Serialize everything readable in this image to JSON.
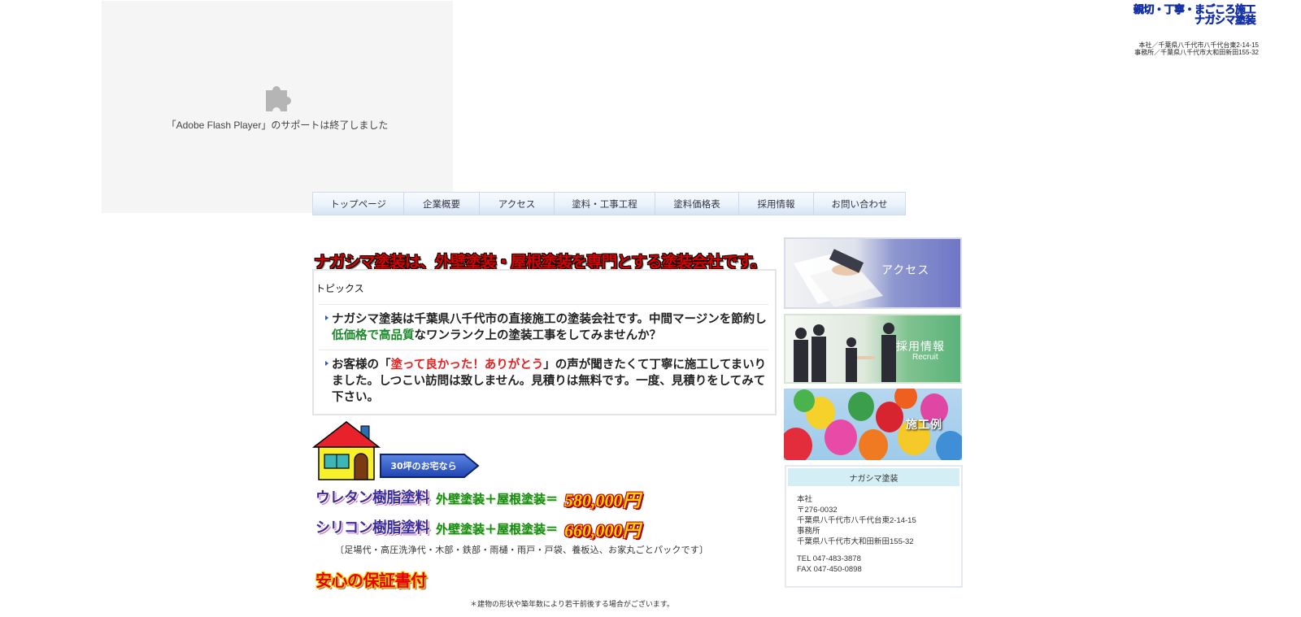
{
  "flash": {
    "message": "「Adobe Flash Player」のサポートは終了しました",
    "icon": "puzzle-piece-icon"
  },
  "header": {
    "title_line1": "親切・丁寧・まごころ施工",
    "title_line2": "ナガシマ塗装",
    "addr_line1": "本社／千葉県八千代市八千代台東2-14-15",
    "addr_line2": "事務所／千葉県八千代市大和田新田155-32"
  },
  "nav": {
    "items": [
      {
        "label": "トップページ"
      },
      {
        "label": "企業概要"
      },
      {
        "label": "アクセス"
      },
      {
        "label": "塗料・工事工程"
      },
      {
        "label": "塗料価格表"
      },
      {
        "label": "採用情報"
      },
      {
        "label": "お問い合わせ"
      }
    ]
  },
  "headline": "ナガシマ塗装は、外壁塗装・屋根塗装を専門とする塗装会社です。",
  "topics": {
    "title": "トピックス",
    "item1": {
      "part1": "ナガシマ塗装は千葉県八千代市の直接施工の塗装会社です。中間マージンを節約し",
      "highlight": "低価格で高品質",
      "part2": "なワンランク上の塗装工事をしてみませんか？"
    },
    "item2": {
      "part1": "お客様の「",
      "highlight": "塗って良かった！ありがとう",
      "part2": "」の声が聞きたくて丁寧に施工してまいりました。しつこい訪問は致しません。見積りは無料です。一度、見積りをしてみて下さい。"
    }
  },
  "ad": {
    "button_30": "30坪のお宅なら",
    "rows": [
      {
        "name": "ウレタン樹脂塗料",
        "desc": "外壁塗装＋屋根塗装＝",
        "price": "580,000円"
      },
      {
        "name": "シリコン樹脂塗料",
        "desc": "外壁塗装＋屋根塗装＝",
        "price": "660,000円"
      }
    ],
    "pack_note": "〔足場代・高圧洗浄代・木部・鉄部・雨樋・雨戸・戸袋、養板込、お家丸ごとパックです〕",
    "guarantee": "安心の保証書付",
    "footnote": "＊建物の形状や築年数により若干前後する場合がございます。"
  },
  "banners": {
    "access": "アクセス",
    "recruit": "採用情報",
    "recruit_sub": "Recruit",
    "works": "施工例"
  },
  "company": {
    "heading": "ナガシマ塗装",
    "lines": [
      "本社",
      "〒276-0032",
      "千葉県八千代市八千代台東2-14-15",
      "事務所",
      "千葉県八千代市大和田新田155-32"
    ],
    "tel": "TEL 047-483-3878",
    "fax": "FAX 047-450-0898"
  },
  "colors": {
    "accent_blue": "#1431a8",
    "headline_red": "#d80000",
    "highlight_green": "#1c8a2b",
    "highlight_red": "#e82020"
  }
}
